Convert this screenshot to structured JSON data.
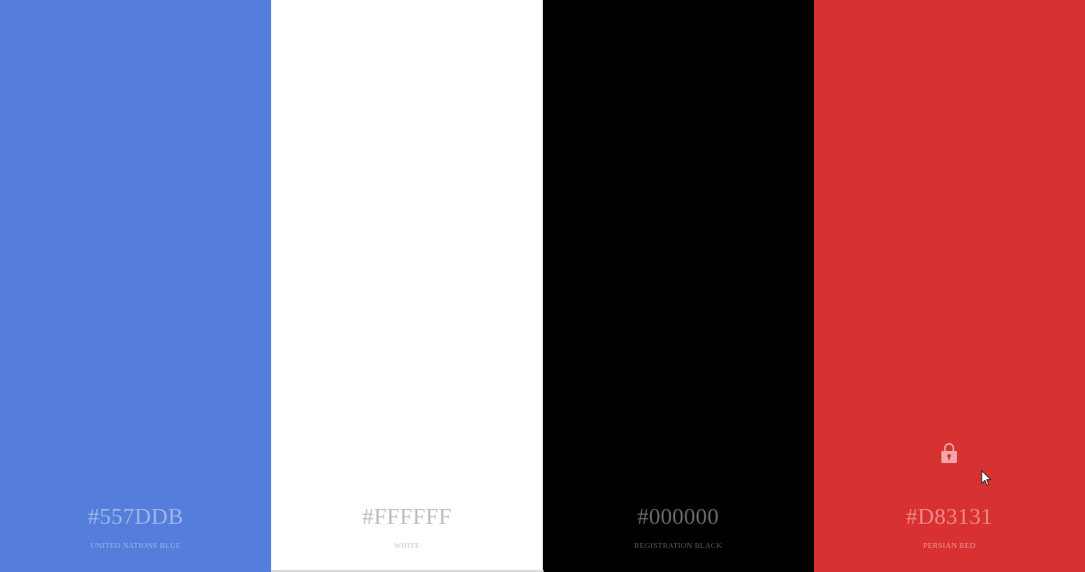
{
  "palette": {
    "swatches": [
      {
        "hex": "#557DDB",
        "name": "UNITED NATIONS BLUE",
        "color": "#557ddb",
        "text_color": "#9fb6ea",
        "name_color": "#9fb6ea"
      },
      {
        "hex": "#FFFFFF",
        "name": "WHITE",
        "color": "#ffffff",
        "text_color": "#bdbdbd",
        "name_color": "#c4c4c4"
      },
      {
        "hex": "#000000",
        "name": "REGISTRATION BLACK",
        "color": "#000000",
        "text_color": "#6a6a6a",
        "name_color": "#5e5e5e"
      },
      {
        "hex": "#D83131",
        "name": "PERSIAN RED",
        "color": "#d83131",
        "text_color": "#ed8989",
        "name_color": "#ef9a9a"
      }
    ],
    "lock_icon": "lock-icon",
    "lock_on_swatch": 3
  }
}
